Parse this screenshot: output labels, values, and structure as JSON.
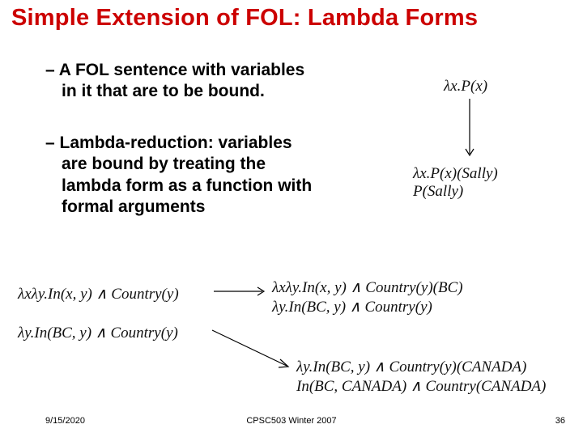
{
  "title": "Simple Extension of FOL: Lambda Forms",
  "bullets": {
    "b1_line1": "– A FOL sentence with variables",
    "b1_line2": "in it that are to be bound.",
    "b2_line1": "– Lambda-reduction: variables",
    "b2_line2": "are bound by treating the",
    "b2_line3": "lambda form as a function with",
    "b2_line4": "formal arguments"
  },
  "formulas": {
    "topRight1": "λx.P(x)",
    "topRight2_l1": "λx.P(x)(Sally)",
    "topRight2_l2": "P(Sally)",
    "left1": "λxλy.In(x, y) ∧ Country(y)",
    "left2": "λy.In(BC, y) ∧ Country(y)",
    "mid1": "λxλy.In(x, y) ∧ Country(y)(BC)",
    "mid2": "λy.In(BC, y) ∧ Country(y)",
    "right1": "λy.In(BC, y) ∧ Country(y)(CANADA)",
    "right2": "In(BC, CANADA) ∧ Country(CANADA)"
  },
  "footer": {
    "date": "9/15/2020",
    "center": "CPSC503 Winter 2007",
    "page": "36"
  }
}
